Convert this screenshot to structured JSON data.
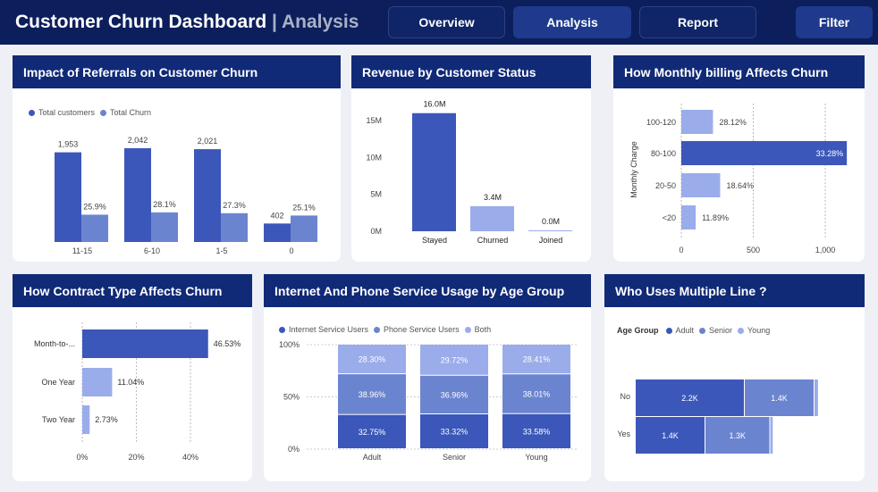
{
  "header": {
    "title": "Customer Churn Dashboard",
    "separator": "|",
    "subtitle": "Analysis",
    "nav": [
      "Overview",
      "Analysis",
      "Report"
    ],
    "filter_label": "Filter"
  },
  "colors": {
    "primary": "#3b57b9",
    "secondary": "#6b84cf",
    "light": "#9aacea",
    "header": "#102a77"
  },
  "referrals": {
    "title": "Impact of Referrals on Customer Churn",
    "legend": [
      "Total customers",
      "Total Churn"
    ],
    "chart_data": {
      "type": "bar",
      "categories": [
        "11-15",
        "6-10",
        "1-5",
        "0"
      ],
      "series": [
        {
          "name": "Total customers",
          "values": [
            1953,
            2042,
            2021,
            402
          ],
          "labels": [
            "1,953",
            "2,042",
            "2,021",
            "402"
          ]
        },
        {
          "name": "Total Churn",
          "values": [
            25.9,
            28.1,
            27.3,
            25.1
          ],
          "labels": [
            "25.9%",
            "28.1%",
            "27.3%",
            "25.1%"
          ]
        }
      ]
    }
  },
  "revenue": {
    "title": "Revenue by Customer Status",
    "chart_data": {
      "type": "bar",
      "categories": [
        "Stayed",
        "Churned",
        "Joined"
      ],
      "values": [
        16.0,
        3.4,
        0.0
      ],
      "labels": [
        "16.0M",
        "3.4M",
        "0.0M"
      ],
      "yticks": [
        "0M",
        "5M",
        "10M",
        "15M"
      ],
      "ylim": [
        0,
        17
      ]
    }
  },
  "billing": {
    "title": "How Monthly billing Affects Churn",
    "ylabel": "Monthly Charge",
    "chart_data": {
      "type": "bar",
      "categories": [
        "100-120",
        "80-100",
        "20-50",
        "<20"
      ],
      "values": [
        220,
        1150,
        270,
        100
      ],
      "labels": [
        "28.12%",
        "33.28%",
        "18.64%",
        "11.89%"
      ],
      "xticks": [
        "0",
        "500",
        "1,000"
      ],
      "xlim": [
        0,
        1200
      ]
    }
  },
  "contract": {
    "title": "How Contract Type Affects Churn",
    "chart_data": {
      "type": "bar",
      "categories": [
        "Month-to-...",
        "One Year",
        "Two Year"
      ],
      "values": [
        46.53,
        11.04,
        2.73
      ],
      "labels": [
        "46.53%",
        "11.04%",
        "2.73%"
      ],
      "xticks": [
        "0%",
        "20%",
        "40%"
      ],
      "xlim": [
        0,
        50
      ]
    }
  },
  "usage": {
    "title": "Internet And Phone Service Usage by Age Group",
    "legend": [
      "Internet Service Users",
      "Phone Service Users",
      "Both"
    ],
    "chart_data": {
      "type": "bar",
      "categories": [
        "Adult",
        "Senior",
        "Young"
      ],
      "series": [
        {
          "name": "Internet Service Users",
          "values": [
            32.75,
            33.32,
            33.58
          ],
          "labels": [
            "32.75%",
            "33.32%",
            "33.58%"
          ]
        },
        {
          "name": "Phone Service Users",
          "values": [
            38.96,
            36.96,
            38.01
          ],
          "labels": [
            "38.96%",
            "36.96%",
            "38.01%"
          ]
        },
        {
          "name": "Both",
          "values": [
            28.3,
            29.72,
            28.41
          ],
          "labels": [
            "28.30%",
            "29.72%",
            "28.41%"
          ]
        }
      ],
      "yticks": [
        "0%",
        "50%",
        "100%"
      ]
    }
  },
  "multiline": {
    "title": "Who Uses Multiple Line ?",
    "legend_title": "Age Group",
    "legend": [
      "Adult",
      "Senior",
      "Young"
    ],
    "chart_data": {
      "type": "bar",
      "categories": [
        "No",
        "Yes"
      ],
      "series": [
        {
          "name": "Adult",
          "values": [
            2.2,
            1.4
          ],
          "labels": [
            "2.2K",
            "1.4K"
          ]
        },
        {
          "name": "Senior",
          "values": [
            1.4,
            1.3
          ],
          "labels": [
            "1.4K",
            "1.3K"
          ]
        },
        {
          "name": "Young",
          "values": [
            0.07,
            0.05
          ],
          "labels": [
            "",
            ""
          ]
        }
      ]
    }
  }
}
